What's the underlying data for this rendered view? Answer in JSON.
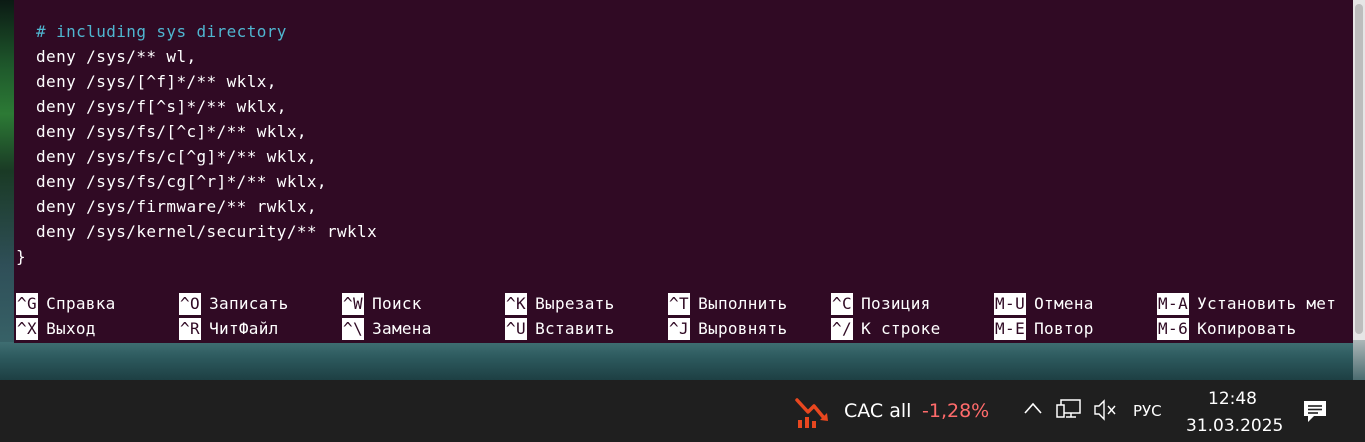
{
  "editor": {
    "lines": [
      {
        "text": "# including sys directory",
        "comment": true
      },
      {
        "text": "deny /sys/** wl,",
        "comment": false
      },
      {
        "text": "deny /sys/[^f]*/** wklx,",
        "comment": false
      },
      {
        "text": "deny /sys/f[^s]*/** wklx,",
        "comment": false
      },
      {
        "text": "deny /sys/fs/[^c]*/** wklx,",
        "comment": false
      },
      {
        "text": "deny /sys/fs/c[^g]*/** wklx,",
        "comment": false
      },
      {
        "text": "deny /sys/fs/cg[^r]*/** wklx,",
        "comment": false
      },
      {
        "text": "deny /sys/firmware/** rwklx,",
        "comment": false
      },
      {
        "text": "deny /sys/kernel/security/** rwklx",
        "comment": false
      }
    ],
    "closing_brace": "}"
  },
  "shortcuts": {
    "row1": [
      {
        "key": "^G",
        "label": "Справка"
      },
      {
        "key": "^O",
        "label": "Записать"
      },
      {
        "key": "^W",
        "label": "Поиск"
      },
      {
        "key": "^K",
        "label": "Вырезать"
      },
      {
        "key": "^T",
        "label": "Выполнить"
      },
      {
        "key": "^C",
        "label": "Позиция"
      },
      {
        "key": "M-U",
        "label": "Отмена"
      },
      {
        "key": "M-A",
        "label": "Установить мет"
      }
    ],
    "row2": [
      {
        "key": "^X",
        "label": "Выход"
      },
      {
        "key": "^R",
        "label": "ЧитФайл"
      },
      {
        "key": "^\\",
        "label": "Замена"
      },
      {
        "key": "^U",
        "label": "Вставить"
      },
      {
        "key": "^J",
        "label": "Выровнять"
      },
      {
        "key": "^/",
        "label": "К строке"
      },
      {
        "key": "M-E",
        "label": "Повтор"
      },
      {
        "key": "M-6",
        "label": "Копировать"
      }
    ]
  },
  "taskbar": {
    "stock_name": "CAC all",
    "stock_change": "-1,28%",
    "stock_change_color": "#ff6b6b",
    "language": "РУС",
    "time": "12:48",
    "date": "31.03.2025",
    "icons": [
      "stock-chart-down-icon",
      "chevron-up-icon",
      "network-icon",
      "volume-muted-icon",
      "notifications-icon"
    ]
  },
  "colors": {
    "terminal_bg": "#300a24",
    "comment": "#4fb6d0",
    "taskbar_bg": "#1f1f1f"
  }
}
